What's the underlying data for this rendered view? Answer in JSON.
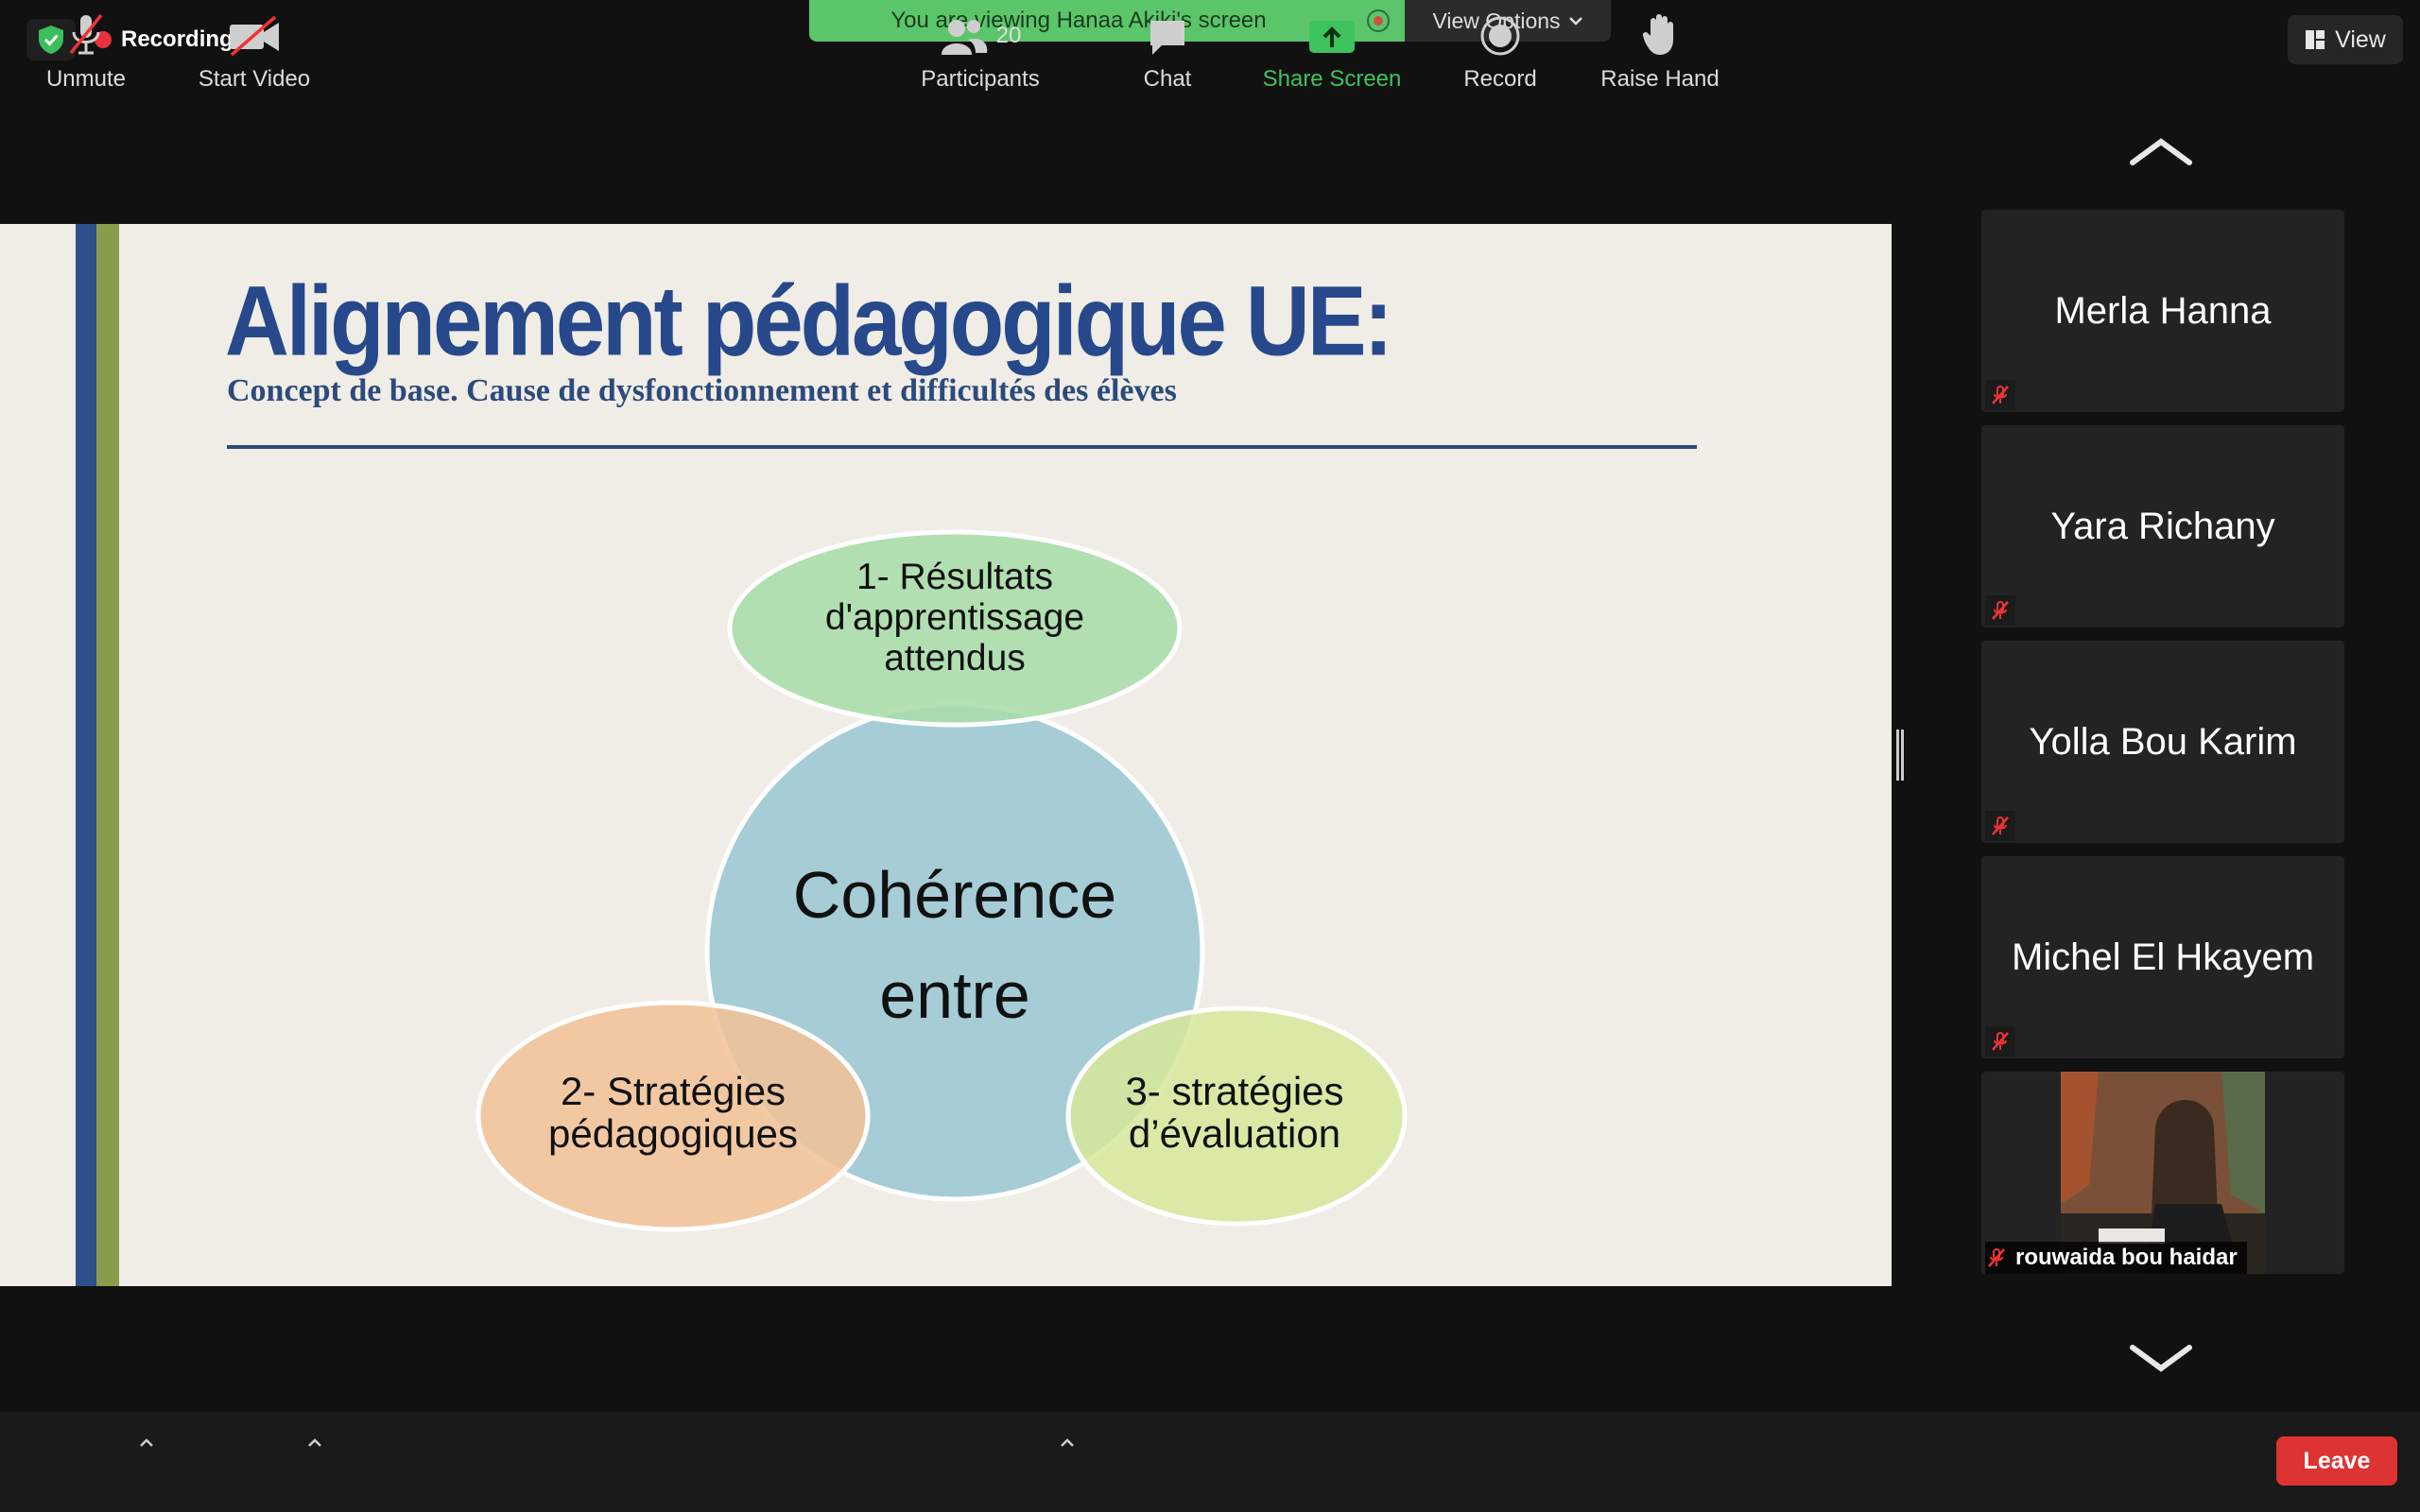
{
  "top_bar": {
    "recording_label": "Recording",
    "viewing_banner": "You are viewing Hanaa Akiki's screen",
    "view_options_label": "View Options",
    "view_label": "View"
  },
  "slide": {
    "title": "Alignement pédagogique UE:",
    "subtitle": "Concept de base. Cause de dysfonctionnement et difficultés des élèves",
    "center_line1": "Cohérence",
    "center_line2": "entre",
    "item1_line1": "1- Résultats",
    "item1_line2": "d'apprentissage",
    "item1_line3": "attendus",
    "item2_line1": "2- Stratégies",
    "item2_line2": "pédagogiques",
    "item3_line1": "3- stratégies",
    "item3_line2": "d’évaluation",
    "colors": {
      "title": "#27488b",
      "circle_center": "#a6cdd6",
      "ellipse1": "#a8ddaa",
      "ellipse2": "#f2c197",
      "ellipse3": "#d6e89a"
    }
  },
  "participants_gallery": [
    {
      "name": "Merla Hanna",
      "muted": true
    },
    {
      "name": "Yara Richany",
      "muted": true
    },
    {
      "name": "Yolla Bou Karim",
      "muted": true
    },
    {
      "name": "Michel El Hkayem",
      "muted": true
    },
    {
      "name": "rouwaida bou haidar",
      "muted": true,
      "video": true
    }
  ],
  "toolbar": {
    "unmute_label": "Unmute",
    "start_video_label": "Start Video",
    "participants_label": "Participants",
    "participants_count": "20",
    "chat_label": "Chat",
    "share_screen_label": "Share Screen",
    "record_label": "Record",
    "raise_hand_label": "Raise Hand",
    "leave_label": "Leave"
  }
}
